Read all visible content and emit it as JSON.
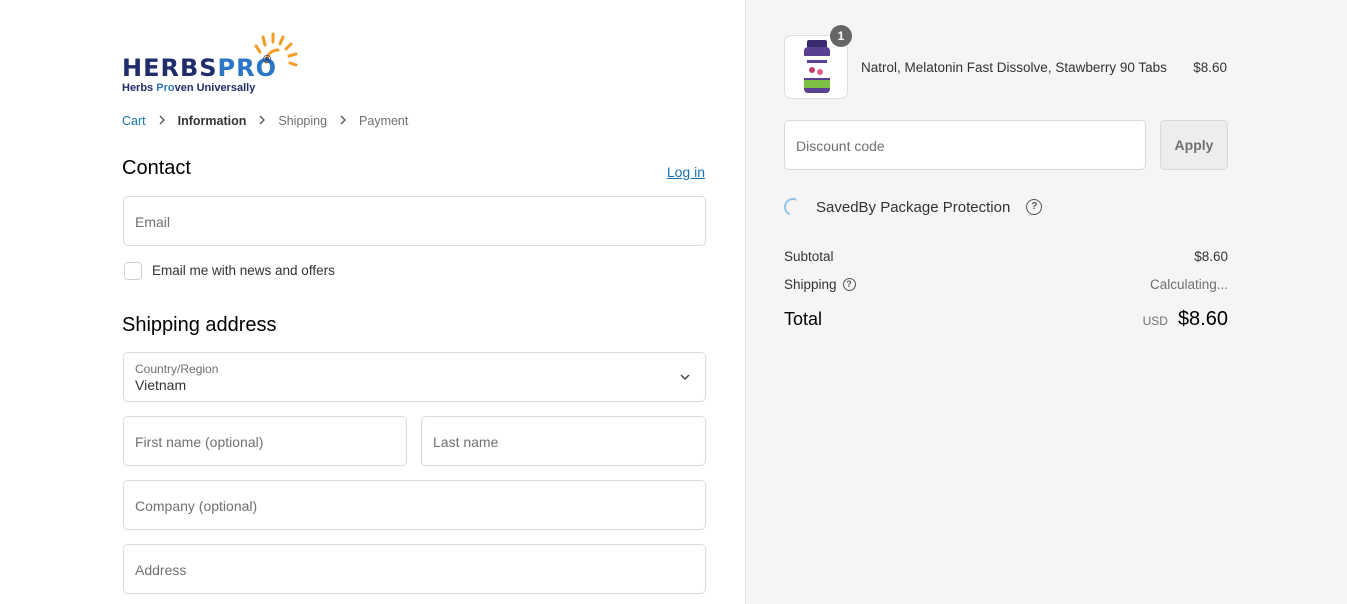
{
  "logo": {
    "brand_main": "HERBS",
    "brand_accent": "PRO",
    "registered": "®",
    "tagline_a": "Herbs ",
    "tagline_b": "Pro",
    "tagline_c": "ven Universally",
    "sun_color": "#f39c26",
    "navy": "#1f2d6b",
    "blue": "#2a76c7"
  },
  "breadcrumb": {
    "items": [
      "Cart",
      "Information",
      "Shipping",
      "Payment"
    ],
    "separator_icon": "chevron-right-icon"
  },
  "contact": {
    "heading": "Contact",
    "login_link": "Log in",
    "email_placeholder": "Email",
    "newsletter_label": "Email me with news and offers",
    "newsletter_checked": false
  },
  "shipping": {
    "heading": "Shipping address",
    "country_label": "Country/Region",
    "country_value": "Vietnam",
    "first_name_placeholder": "First name (optional)",
    "last_name_placeholder": "Last name",
    "company_placeholder": "Company (optional)",
    "address_placeholder": "Address"
  },
  "summary": {
    "item": {
      "quantity": "1",
      "name": "Natrol, Melatonin Fast Dissolve, Stawberry 90 Tabs",
      "price": "$8.60"
    },
    "discount_placeholder": "Discount code",
    "apply_label": "Apply",
    "protection_label": "SavedBy Package Protection",
    "subtotal_label": "Subtotal",
    "subtotal_value": "$8.60",
    "shipping_label": "Shipping",
    "shipping_value": "Calculating...",
    "total_label": "Total",
    "total_currency": "USD",
    "total_value": "$8.60"
  },
  "colors": {
    "link": "#1773b0",
    "panel_bg": "#f5f5f5",
    "border": "#d9d9d9"
  }
}
